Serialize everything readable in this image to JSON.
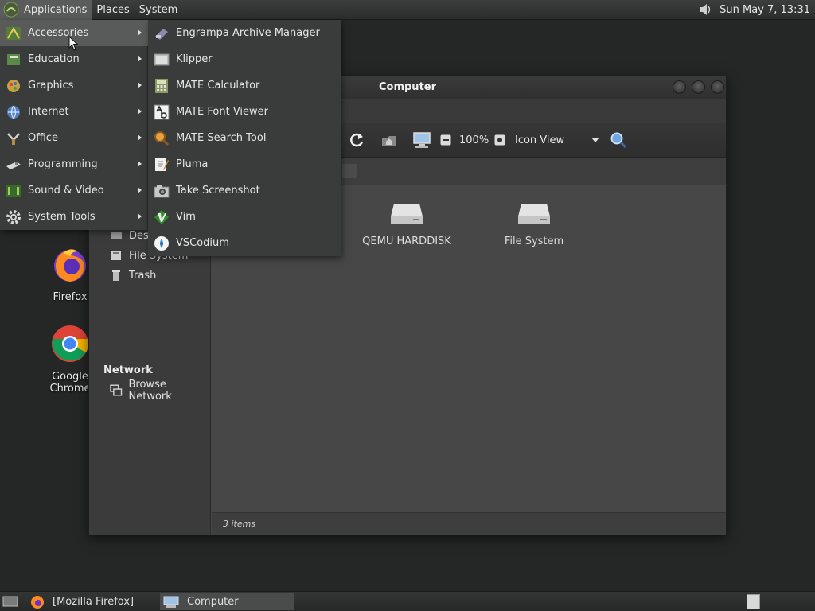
{
  "top_panel": {
    "applications": "Applications",
    "places": "Places",
    "system": "System",
    "clock": "Sun May  7, 13:31",
    "icons": {
      "logo": "mate-logo-icon",
      "volume": "volume-icon"
    }
  },
  "desktop": {
    "icons": [
      {
        "label": "Firefox",
        "icon": "firefox-icon"
      },
      {
        "label": "Google Chrome",
        "icon": "chrome-icon"
      }
    ]
  },
  "window": {
    "title": "Computer",
    "zoom": "100%",
    "view_mode": "Icon View",
    "sidebar": {
      "items": [
        {
          "label": "Desktop",
          "icon": "desktop-folder-icon"
        },
        {
          "label": "File System",
          "icon": "filesystem-icon"
        },
        {
          "label": "Trash",
          "icon": "trash-icon"
        }
      ],
      "network_heading": "Network",
      "network_items": [
        {
          "label": "Browse Network",
          "icon": "network-icon"
        }
      ]
    },
    "files": [
      {
        "label": "QEMU HARDDISK",
        "icon": "harddisk-icon"
      },
      {
        "label": "File System",
        "icon": "harddisk-icon"
      }
    ],
    "status": "3 items"
  },
  "applications_menu": {
    "categories": [
      {
        "label": "Accessories",
        "icon": "accessories-icon"
      },
      {
        "label": "Education",
        "icon": "education-icon"
      },
      {
        "label": "Graphics",
        "icon": "graphics-icon"
      },
      {
        "label": "Internet",
        "icon": "internet-icon"
      },
      {
        "label": "Office",
        "icon": "office-icon"
      },
      {
        "label": "Programming",
        "icon": "programming-icon"
      },
      {
        "label": "Sound & Video",
        "icon": "sound-video-icon"
      },
      {
        "label": "System Tools",
        "icon": "system-tools-icon"
      }
    ],
    "accessories": [
      {
        "label": "Engrampa Archive Manager",
        "icon": "archive-icon"
      },
      {
        "label": "Klipper",
        "icon": "clipboard-icon"
      },
      {
        "label": "MATE Calculator",
        "icon": "calculator-icon"
      },
      {
        "label": "MATE Font Viewer",
        "icon": "font-icon"
      },
      {
        "label": "MATE Search Tool",
        "icon": "search-tool-icon"
      },
      {
        "label": "Pluma",
        "icon": "text-editor-icon"
      },
      {
        "label": "Take Screenshot",
        "icon": "camera-icon"
      },
      {
        "label": "Vim",
        "icon": "vim-icon"
      },
      {
        "label": "VSCodium",
        "icon": "vscodium-icon"
      }
    ]
  },
  "taskbar": {
    "tasks": [
      {
        "label": "[Mozilla Firefox]",
        "icon": "firefox-icon"
      },
      {
        "label": "Computer",
        "icon": "computer-icon"
      }
    ]
  }
}
